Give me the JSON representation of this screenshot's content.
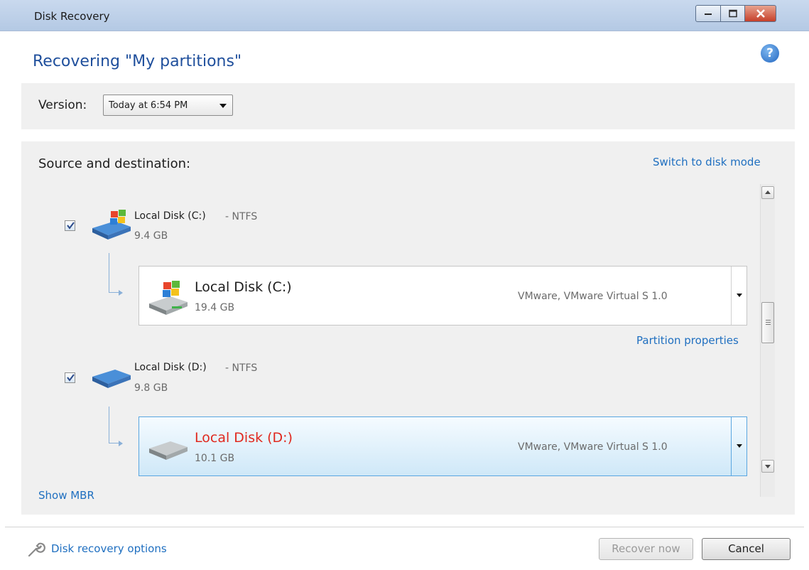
{
  "window": {
    "title": "Disk Recovery",
    "controls": [
      "minimize",
      "maximize",
      "close"
    ]
  },
  "header": {
    "title": "Recovering \"My partitions\"",
    "help_icon": "question-circle-icon",
    "help_glyph": "?"
  },
  "version": {
    "label": "Version:",
    "selected": "Today at 6:54 PM"
  },
  "source": {
    "title": "Source and destination:",
    "switch_link": "Switch to disk mode",
    "show_mbr": "Show MBR",
    "partition_properties": "Partition properties",
    "items": [
      {
        "checked": true,
        "name": "Local Disk (C:)",
        "fs": "- NTFS",
        "size": "9.4 GB",
        "icon": "windows-drive-icon",
        "dest": {
          "name": "Local Disk (C:)",
          "size": "19.4 GB",
          "info": "VMware, VMware Virtual S 1.0",
          "icon": "windows-drive-icon",
          "selected": false,
          "name_color": "#1e1e1e"
        }
      },
      {
        "checked": true,
        "name": "Local Disk (D:)",
        "fs": "- NTFS",
        "size": "9.8 GB",
        "icon": "drive-icon",
        "dest": {
          "name": "Local Disk (D:)",
          "size": "10.1 GB",
          "info": "VMware, VMware Virtual S 1.0",
          "icon": "gray-drive-icon",
          "selected": true,
          "name_color": "#e0291f"
        }
      }
    ]
  },
  "footer": {
    "options_link": "Disk recovery options",
    "recover_button": "Recover now",
    "recover_enabled": false,
    "cancel_button": "Cancel"
  },
  "colors": {
    "accent": "#1f6fc0",
    "heading": "#1f4f9c",
    "error_red": "#e0291f",
    "panel_bg": "#f0f0f0"
  }
}
